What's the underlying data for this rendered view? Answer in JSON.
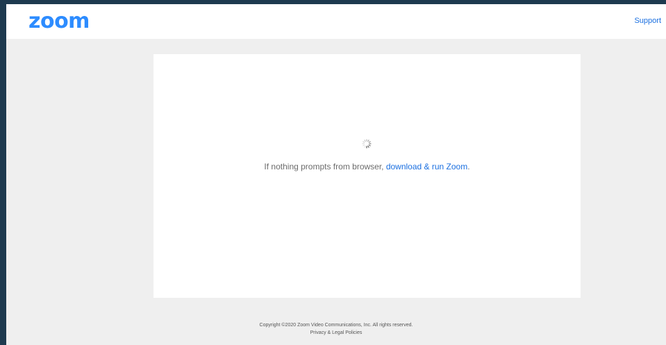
{
  "header": {
    "logo_text": "zoom",
    "support_label": "Support"
  },
  "main": {
    "prompt_text": "If nothing prompts from browser, ",
    "download_link_label": "download & run Zoom",
    "prompt_end": "."
  },
  "footer": {
    "copyright": "Copyright ©2020 Zoom Video Communications, Inc. All rights reserved.",
    "policies_link_label": "Privacy & Legal Policies"
  },
  "colors": {
    "brand_blue": "#2d8cff",
    "link_blue": "#1a6fe0",
    "page_background": "#efefef",
    "outer_border": "#1e3a4f"
  },
  "icons": {
    "spinner": "loading-spinner-icon"
  }
}
